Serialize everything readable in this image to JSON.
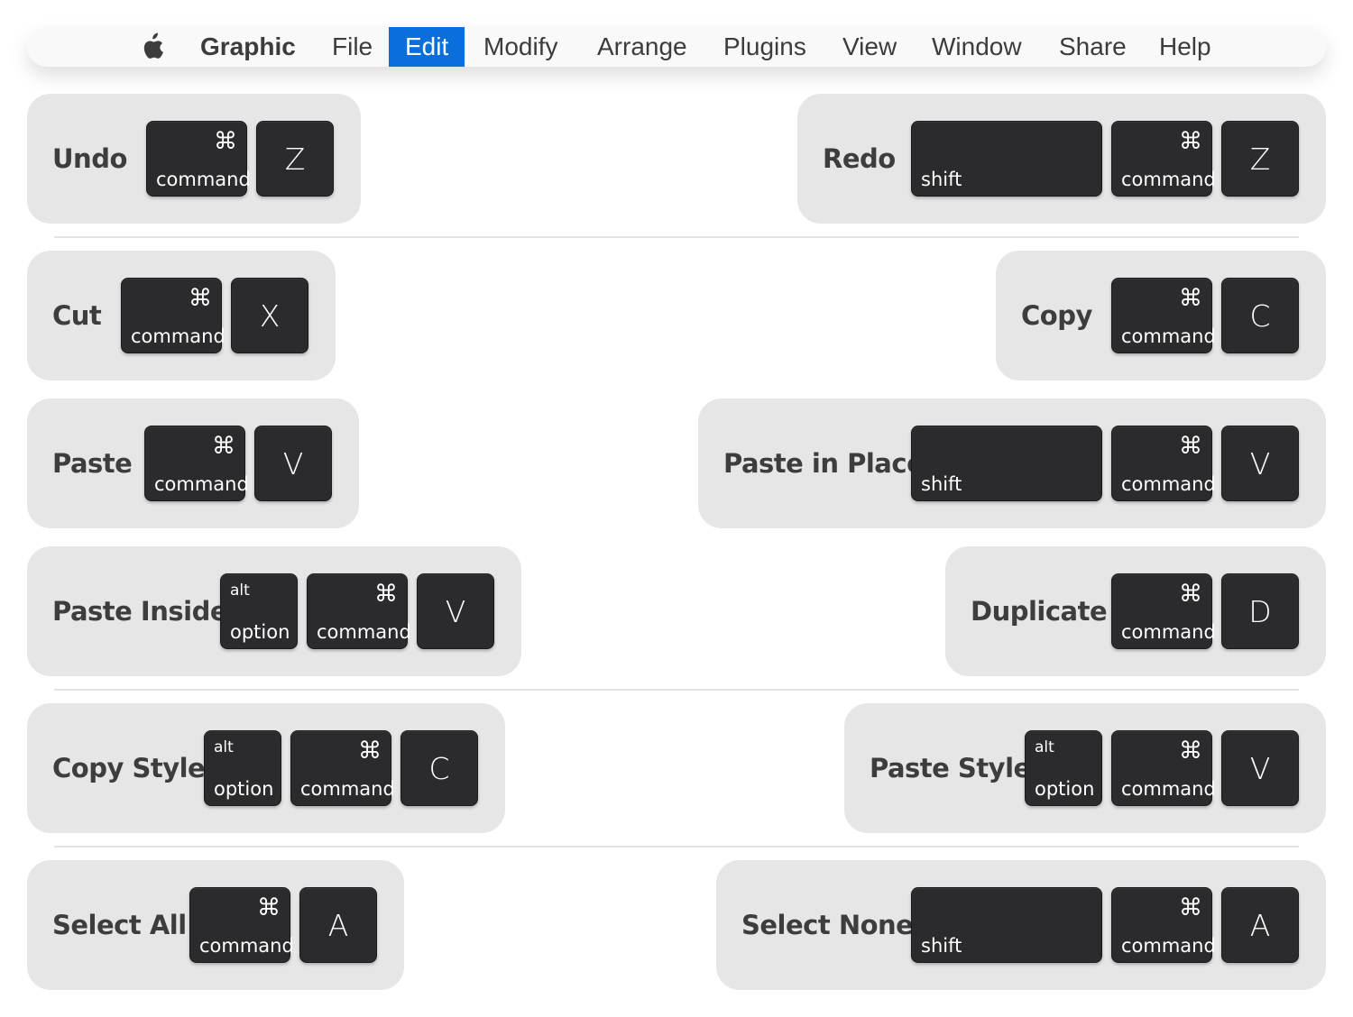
{
  "menubar": {
    "apple_icon": "apple-logo-icon",
    "items": [
      {
        "label": "Graphic",
        "bold": true
      },
      {
        "label": "File"
      },
      {
        "label": "Edit",
        "active": true
      },
      {
        "label": "Modify"
      },
      {
        "label": "Arrange"
      },
      {
        "label": "Plugins"
      },
      {
        "label": "View"
      },
      {
        "label": "Window"
      },
      {
        "label": "Share"
      },
      {
        "label": "Help"
      }
    ],
    "active_color": "#0a6fdb"
  },
  "keys": {
    "command_symbol": "⌘",
    "command": "command",
    "shift": "shift",
    "option": "option",
    "alt": "alt"
  },
  "shortcuts": [
    {
      "action": "Undo",
      "keys": [
        "command",
        "Z"
      ]
    },
    {
      "action": "Redo",
      "keys": [
        "shift",
        "command",
        "Z"
      ]
    },
    {
      "action": "Cut",
      "keys": [
        "command",
        "X"
      ]
    },
    {
      "action": "Copy",
      "keys": [
        "command",
        "C"
      ]
    },
    {
      "action": "Paste",
      "keys": [
        "command",
        "V"
      ]
    },
    {
      "action": "Paste in Place",
      "keys": [
        "shift",
        "command",
        "V"
      ]
    },
    {
      "action": "Paste Inside",
      "keys": [
        "option",
        "command",
        "V"
      ]
    },
    {
      "action": "Duplicate",
      "keys": [
        "command",
        "D"
      ]
    },
    {
      "action": "Copy Style",
      "keys": [
        "option",
        "command",
        "C"
      ]
    },
    {
      "action": "Paste Style",
      "keys": [
        "option",
        "command",
        "V"
      ]
    },
    {
      "action": "Select All",
      "keys": [
        "command",
        "A"
      ]
    },
    {
      "action": "Select None",
      "keys": [
        "shift",
        "command",
        "A"
      ]
    }
  ]
}
